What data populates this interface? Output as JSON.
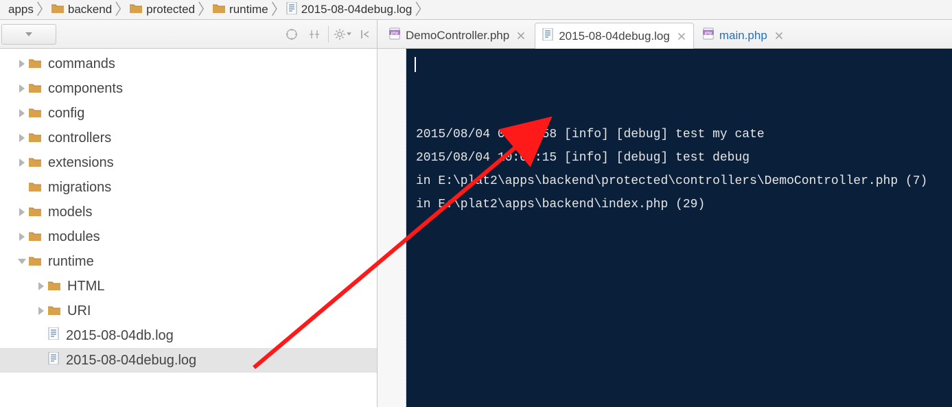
{
  "breadcrumbs": [
    {
      "label": "apps",
      "icon": "folder"
    },
    {
      "label": "backend",
      "icon": "folder"
    },
    {
      "label": "protected",
      "icon": "folder"
    },
    {
      "label": "runtime",
      "icon": "folder"
    },
    {
      "label": "2015-08-04debug.log",
      "icon": "logfile"
    }
  ],
  "tabs": [
    {
      "label": "DemoController.php",
      "icon": "php",
      "active": false,
      "blue": false
    },
    {
      "label": "2015-08-04debug.log",
      "icon": "logfile",
      "active": true,
      "blue": false
    },
    {
      "label": "main.php",
      "icon": "php",
      "active": false,
      "blue": true
    }
  ],
  "tree": [
    {
      "label": "commands",
      "depth": 1,
      "icon": "folder",
      "expandable": true,
      "expanded": false
    },
    {
      "label": "components",
      "depth": 1,
      "icon": "folder",
      "expandable": true,
      "expanded": false
    },
    {
      "label": "config",
      "depth": 1,
      "icon": "folder",
      "expandable": true,
      "expanded": false
    },
    {
      "label": "controllers",
      "depth": 1,
      "icon": "folder",
      "expandable": true,
      "expanded": false
    },
    {
      "label": "extensions",
      "depth": 1,
      "icon": "folder",
      "expandable": true,
      "expanded": false
    },
    {
      "label": "migrations",
      "depth": 1,
      "icon": "folder",
      "expandable": false,
      "expanded": false
    },
    {
      "label": "models",
      "depth": 1,
      "icon": "folder",
      "expandable": true,
      "expanded": false
    },
    {
      "label": "modules",
      "depth": 1,
      "icon": "folder",
      "expandable": true,
      "expanded": false
    },
    {
      "label": "runtime",
      "depth": 1,
      "icon": "folder",
      "expandable": true,
      "expanded": true
    },
    {
      "label": "HTML",
      "depth": 2,
      "icon": "folder",
      "expandable": true,
      "expanded": false
    },
    {
      "label": "URI",
      "depth": 2,
      "icon": "folder",
      "expandable": true,
      "expanded": false
    },
    {
      "label": "2015-08-04db.log",
      "depth": 2,
      "icon": "logfile",
      "expandable": false,
      "expanded": false
    },
    {
      "label": "2015-08-04debug.log",
      "depth": 2,
      "icon": "logfile",
      "expandable": false,
      "expanded": false,
      "selected": true
    }
  ],
  "editor": {
    "lines": [
      "2015/08/04 09:31:58 [info] [debug] test my cate",
      "2015/08/04 10:08:15 [info] [debug] test debug",
      "in E:\\plat2\\apps\\backend\\protected\\controllers\\DemoController.php (7)",
      "in E:\\plat2\\apps\\backend\\index.php (29)"
    ]
  },
  "icons": {
    "php_label": "php"
  }
}
